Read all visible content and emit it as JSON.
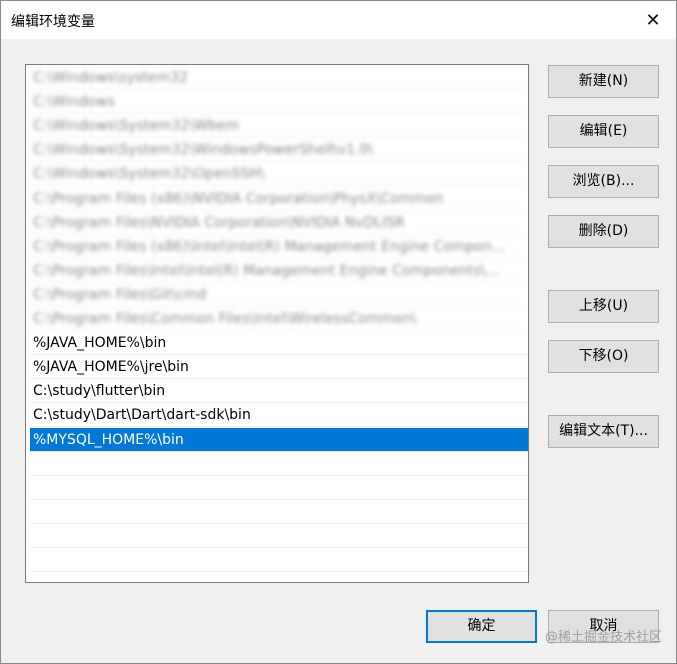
{
  "window": {
    "title": "编辑环境变量",
    "close_glyph": "✕"
  },
  "list": {
    "items": [
      {
        "text": "C:\\Windows\\system32",
        "blurred": true,
        "selected": false
      },
      {
        "text": "C:\\Windows",
        "blurred": true,
        "selected": false
      },
      {
        "text": "C:\\Windows\\System32\\Wbem",
        "blurred": true,
        "selected": false
      },
      {
        "text": "C:\\Windows\\System32\\WindowsPowerShell\\v1.0\\",
        "blurred": true,
        "selected": false
      },
      {
        "text": "C:\\Windows\\System32\\OpenSSH\\",
        "blurred": true,
        "selected": false
      },
      {
        "text": "C:\\Program Files (x86)\\NVIDIA Corporation\\PhysX\\Common",
        "blurred": true,
        "selected": false
      },
      {
        "text": "C:\\Program Files\\NVIDIA Corporation\\NVIDIA NvDLISR",
        "blurred": true,
        "selected": false
      },
      {
        "text": "C:\\Program Files (x86)\\Intel\\Intel(R) Management Engine Compon...",
        "blurred": true,
        "selected": false
      },
      {
        "text": "C:\\Program Files\\Intel\\Intel(R) Management Engine Components\\...",
        "blurred": true,
        "selected": false
      },
      {
        "text": "C:\\Program Files\\Git\\cmd",
        "blurred": true,
        "selected": false
      },
      {
        "text": "C:\\Program Files\\Common Files\\Intel\\WirelessCommon\\",
        "blurred": true,
        "selected": false
      },
      {
        "text": "%JAVA_HOME%\\bin",
        "blurred": false,
        "selected": false
      },
      {
        "text": "%JAVA_HOME%\\jre\\bin",
        "blurred": false,
        "selected": false
      },
      {
        "text": "C:\\study\\flutter\\bin",
        "blurred": false,
        "selected": false
      },
      {
        "text": "C:\\study\\Dart\\Dart\\dart-sdk\\bin",
        "blurred": false,
        "selected": false
      },
      {
        "text": "%MYSQL_HOME%\\bin",
        "blurred": false,
        "selected": true
      },
      {
        "text": "",
        "blurred": false,
        "selected": false
      },
      {
        "text": "",
        "blurred": false,
        "selected": false
      },
      {
        "text": "",
        "blurred": false,
        "selected": false
      },
      {
        "text": "",
        "blurred": false,
        "selected": false
      },
      {
        "text": "",
        "blurred": false,
        "selected": false
      }
    ]
  },
  "buttons": {
    "new": "新建(N)",
    "edit": "编辑(E)",
    "browse": "浏览(B)...",
    "delete": "删除(D)",
    "move_up": "上移(U)",
    "move_down": "下移(O)",
    "edit_text": "编辑文本(T)...",
    "ok": "确定",
    "cancel": "取消"
  },
  "watermark": "@稀土掘金技术社区"
}
